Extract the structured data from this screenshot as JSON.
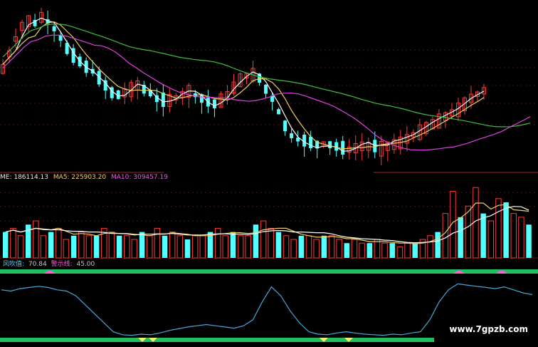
{
  "volume_panel": {
    "prefix": "ME: 186114.13",
    "ma5": "MA5: 225903.20",
    "ma10": "MA10: 309457.19"
  },
  "indicator_panel": {
    "name": "风吹值:",
    "value": "70.84",
    "line_name": "警示线:",
    "line_value": "45.00"
  },
  "watermark": "www.7gpzb.com",
  "colors": {
    "up": "#ff3b3b",
    "down": "#54ffff",
    "ma_short": "#ffffff",
    "ma_mid": "#f0d060",
    "ma_long": "#e040e0",
    "ma_longest": "#40c040",
    "indicator": "#4aa8d8",
    "band": "#20c060"
  },
  "chart_data": {
    "type": "candlestick",
    "title": "",
    "candles_count": 92,
    "price_trend": [
      72,
      80,
      88,
      95,
      98,
      96,
      100,
      97,
      93,
      88,
      82,
      78,
      75,
      72,
      70,
      66,
      62,
      58,
      57,
      59,
      61,
      63,
      60,
      58,
      55,
      54,
      55,
      56,
      58,
      60,
      57,
      55,
      53,
      52,
      55,
      58,
      62,
      66,
      68,
      69,
      66,
      60,
      55,
      48,
      40,
      35,
      33,
      32,
      31,
      30,
      31,
      30,
      29,
      28,
      28,
      29,
      30,
      30,
      29,
      29,
      30,
      31,
      32,
      34,
      36,
      38,
      40,
      42,
      44,
      46,
      48,
      50,
      53,
      56,
      58,
      60
    ],
    "volume_levels": [
      0.35,
      0.4,
      0.3,
      0.45,
      0.5,
      0.3,
      0.35,
      0.4,
      0.25,
      0.3,
      0.35,
      0.3,
      0.3,
      0.4,
      0.35,
      0.3,
      0.3,
      0.25,
      0.35,
      0.3,
      0.4,
      0.3,
      0.35,
      0.3,
      0.25,
      0.3,
      0.3,
      0.35,
      0.4,
      0.3,
      0.35,
      0.3,
      0.3,
      0.45,
      0.5,
      0.4,
      0.35,
      0.3,
      0.25,
      0.3,
      0.3,
      0.25,
      0.3,
      0.3,
      0.25,
      0.2,
      0.25,
      0.2,
      0.2,
      0.25,
      0.2,
      0.2,
      0.15,
      0.2,
      0.2,
      0.25,
      0.3,
      0.35,
      0.6,
      0.9,
      0.55,
      0.7,
      0.95,
      0.6,
      0.5,
      0.8,
      0.75,
      0.6,
      0.55,
      0.45
    ],
    "indicator": {
      "name": "风吹值",
      "latest": 70.84,
      "warning_line": 45.0,
      "trend": [
        80,
        78,
        82,
        84,
        86,
        84,
        80,
        78,
        70,
        55,
        40,
        25,
        10,
        5,
        4,
        6,
        5,
        8,
        12,
        15,
        18,
        20,
        22,
        20,
        18,
        16,
        20,
        30,
        60,
        85,
        70,
        45,
        25,
        10,
        6,
        5,
        8,
        10,
        8,
        6,
        5,
        4,
        6,
        5,
        8,
        10,
        30,
        60,
        80,
        90,
        88,
        86,
        84,
        82,
        85,
        80,
        75,
        72
      ]
    }
  }
}
